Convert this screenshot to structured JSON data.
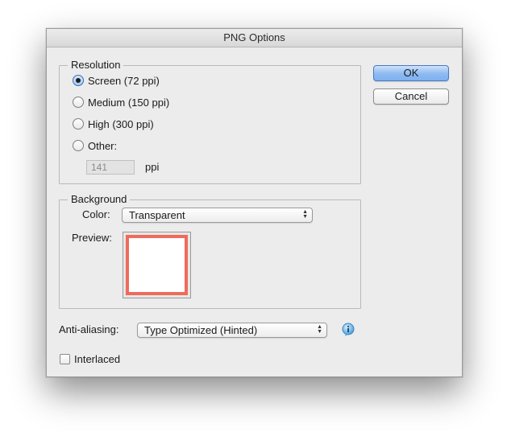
{
  "dialog": {
    "title": "PNG Options"
  },
  "resolution": {
    "group_label": "Resolution",
    "options": [
      {
        "label": "Screen (72 ppi)",
        "selected": true
      },
      {
        "label": "Medium (150 ppi)",
        "selected": false
      },
      {
        "label": "High (300 ppi)",
        "selected": false
      },
      {
        "label": "Other:",
        "selected": false
      }
    ],
    "other_value": "141",
    "other_unit": "ppi"
  },
  "background": {
    "group_label": "Background",
    "color_label": "Color:",
    "color_value": "Transparent",
    "preview_label": "Preview:",
    "preview_border_color": "#ee6b5b"
  },
  "anti_aliasing": {
    "label": "Anti-aliasing:",
    "value": "Type Optimized (Hinted)",
    "info_icon": "info-icon"
  },
  "interlaced": {
    "label": "Interlaced",
    "checked": false
  },
  "buttons": {
    "ok": "OK",
    "cancel": "Cancel"
  },
  "colors": {
    "accent": "#8cbaf1",
    "dialog_bg": "#ececec"
  }
}
